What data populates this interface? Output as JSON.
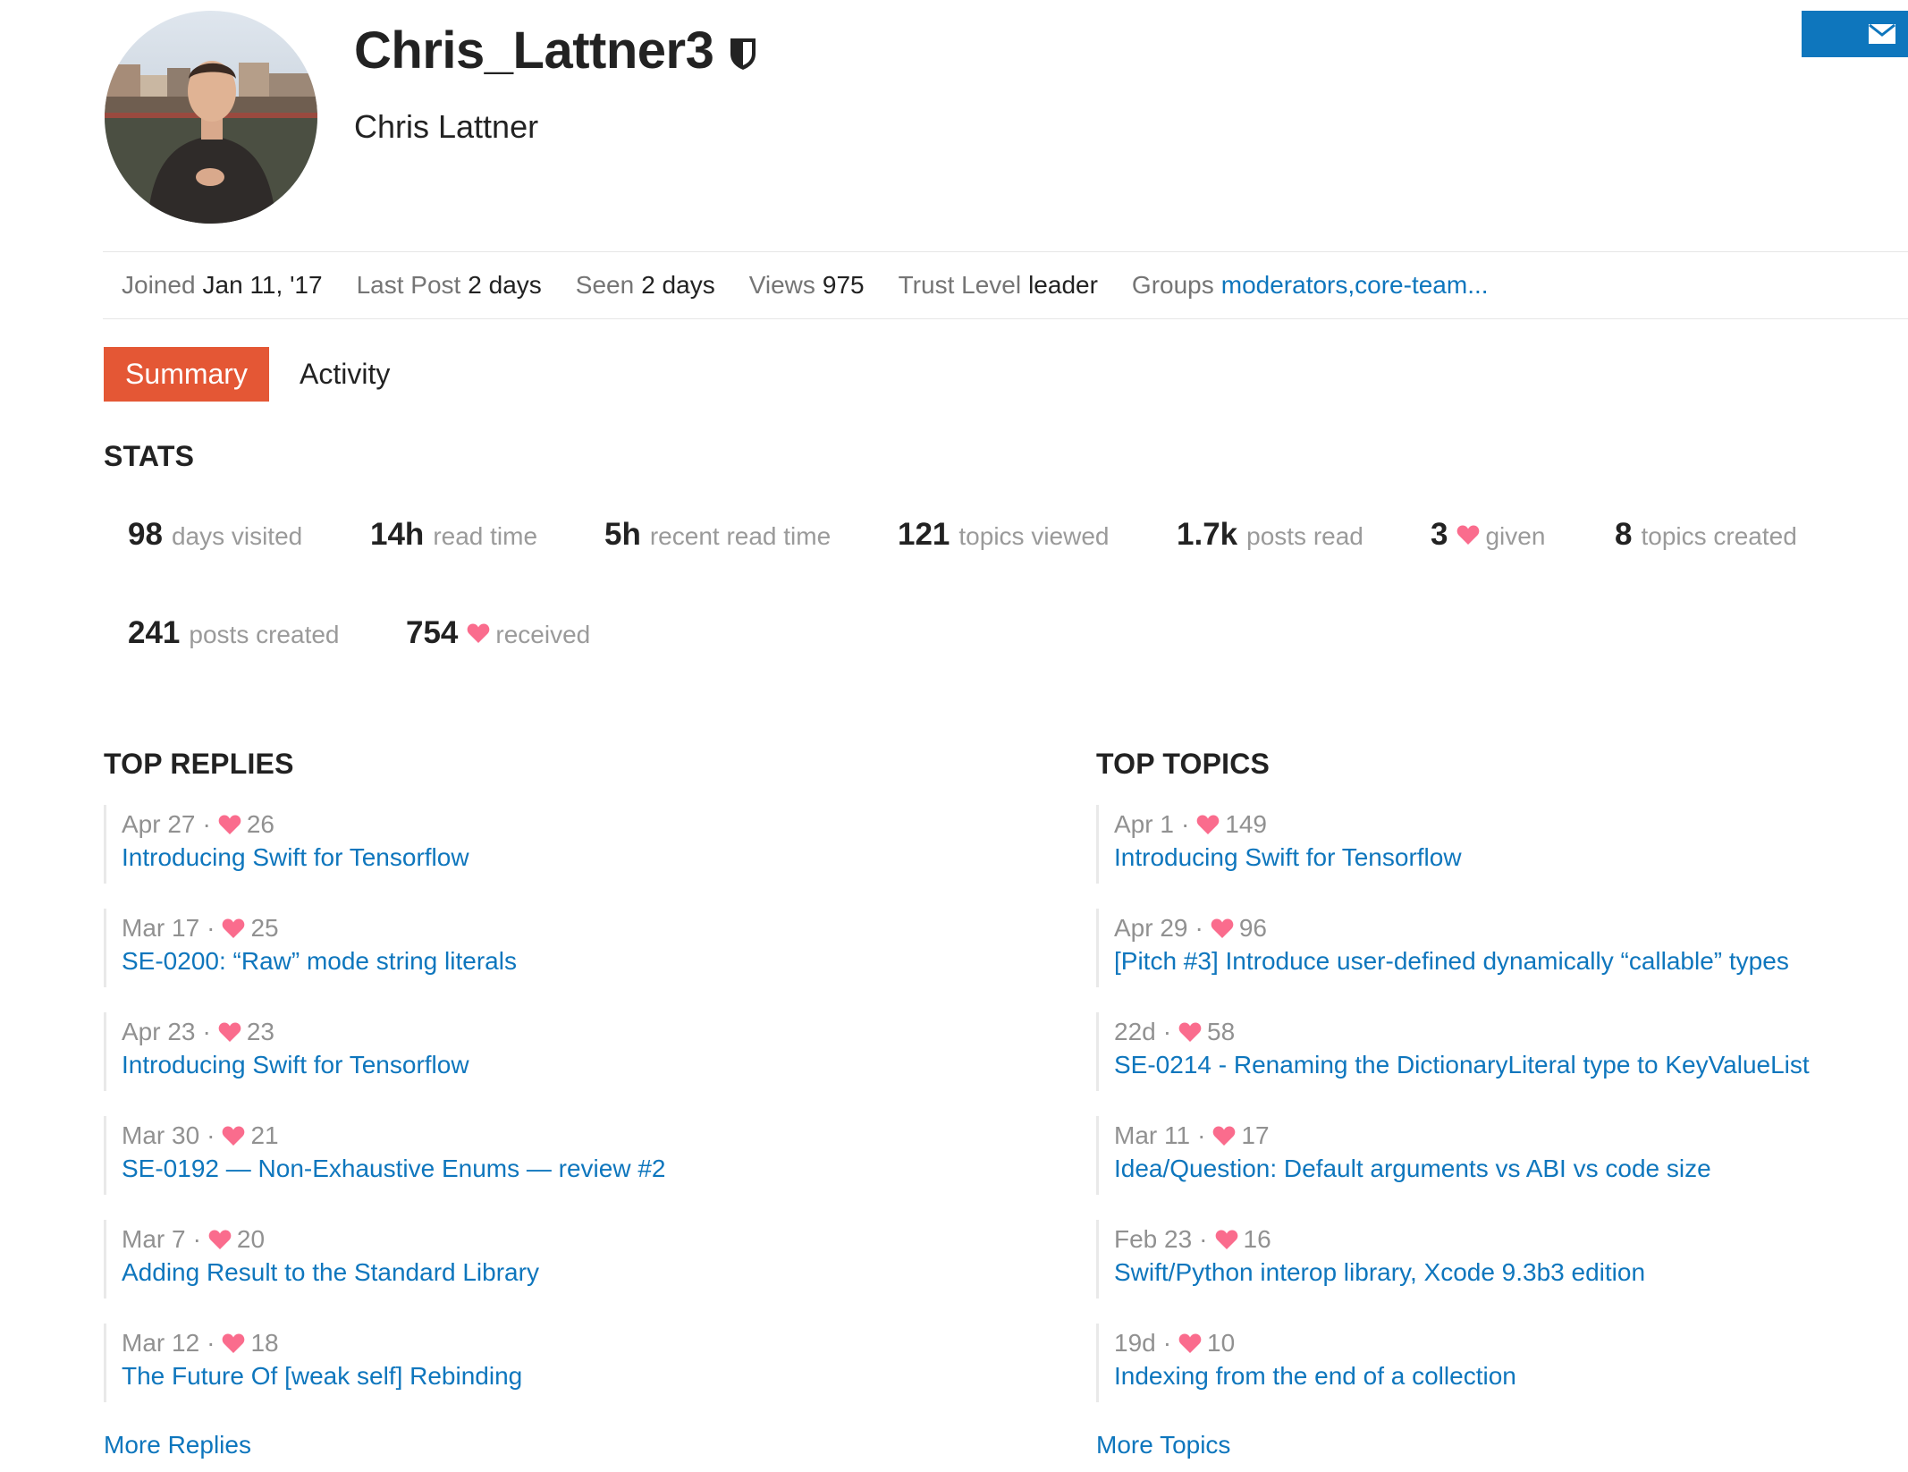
{
  "profile": {
    "username": "Chris_Lattner3",
    "full_name": "Chris Lattner",
    "moderator_icon": "shield-icon",
    "message_icon": "envelope-icon"
  },
  "meta": {
    "joined_label": "Joined",
    "joined_value": "Jan 11, '17",
    "last_post_label": "Last Post",
    "last_post_value": "2 days",
    "seen_label": "Seen",
    "seen_value": "2 days",
    "views_label": "Views",
    "views_value": "975",
    "trust_label": "Trust Level",
    "trust_value": "leader",
    "groups_label": "Groups",
    "groups_value_1": "moderators",
    "groups_sep": ",",
    "groups_value_2": "core-team..."
  },
  "nav": {
    "summary": "Summary",
    "activity": "Activity"
  },
  "stats": {
    "heading": "STATS",
    "items": [
      {
        "value": "98",
        "label": "days visited"
      },
      {
        "value": "14h",
        "label": "read time"
      },
      {
        "value": "5h",
        "label": "recent read time"
      },
      {
        "value": "121",
        "label": "topics viewed"
      },
      {
        "value": "1.7k",
        "label": "posts read"
      },
      {
        "value": "3",
        "label": "given"
      },
      {
        "value": "8",
        "label": "topics created"
      },
      {
        "value": "241",
        "label": "posts created"
      },
      {
        "value": "754",
        "label": "received"
      }
    ]
  },
  "top_replies": {
    "heading": "TOP REPLIES",
    "items": [
      {
        "date": "Apr 27",
        "likes": "26",
        "title": "Introducing Swift for Tensorflow"
      },
      {
        "date": "Mar 17",
        "likes": "25",
        "title": "SE-0200: “Raw” mode string literals"
      },
      {
        "date": "Apr 23",
        "likes": "23",
        "title": "Introducing Swift for Tensorflow"
      },
      {
        "date": "Mar 30",
        "likes": "21",
        "title": "SE-0192 — Non-Exhaustive Enums — review #2"
      },
      {
        "date": "Mar 7",
        "likes": "20",
        "title": "Adding Result to the Standard Library"
      },
      {
        "date": "Mar 12",
        "likes": "18",
        "title": "The Future Of [weak self] Rebinding"
      }
    ],
    "more": "More Replies"
  },
  "top_topics": {
    "heading": "TOP TOPICS",
    "items": [
      {
        "date": "Apr 1",
        "likes": "149",
        "title": "Introducing Swift for Tensorflow"
      },
      {
        "date": "Apr 29",
        "likes": "96",
        "title": "[Pitch #3] Introduce user-defined dynamically “callable” types"
      },
      {
        "date": "22d",
        "likes": "58",
        "title": "SE-0214 - Renaming the DictionaryLiteral type to KeyValueList"
      },
      {
        "date": "Mar 11",
        "likes": "17",
        "title": "Idea/Question: Default arguments vs ABI vs code size"
      },
      {
        "date": "Feb 23",
        "likes": "16",
        "title": "Swift/Python interop library, Xcode 9.3b3 edition"
      },
      {
        "date": "19d",
        "likes": "10",
        "title": "Indexing from the end of a collection"
      }
    ],
    "more": "More Topics"
  },
  "common": {
    "dot": "·"
  },
  "colors": {
    "accent": "#0e76bd",
    "summary_tab": "#e45735",
    "heart": "#fa6c8d"
  }
}
